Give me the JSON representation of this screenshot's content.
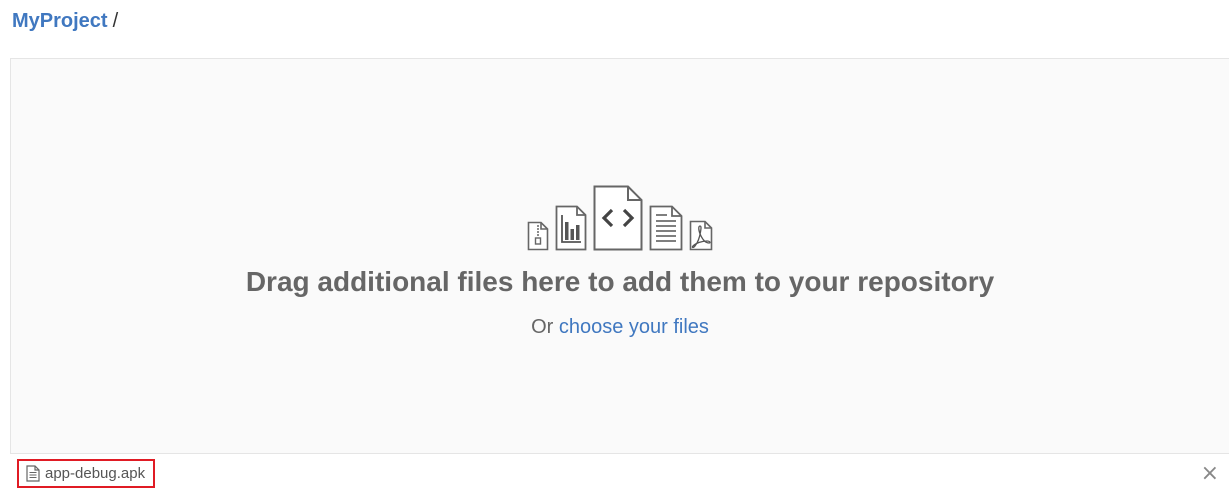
{
  "breadcrumb": {
    "repo_name": "MyProject",
    "separator": "/"
  },
  "dropzone": {
    "icons": [
      "zip-file-icon",
      "chart-file-icon",
      "code-file-icon",
      "text-file-icon",
      "pdf-file-icon"
    ],
    "title": "Drag additional files here to add them to your repository",
    "subtitle_prefix": "Or",
    "choose_link": "choose your files"
  },
  "files": [
    {
      "icon": "file-icon",
      "name": "app-debug.apk"
    }
  ],
  "remove_label": "×",
  "colors": {
    "link": "#4078c0",
    "highlight": "#e01b24",
    "dropzone_bg": "#fafafa",
    "muted_text": "#666666"
  }
}
